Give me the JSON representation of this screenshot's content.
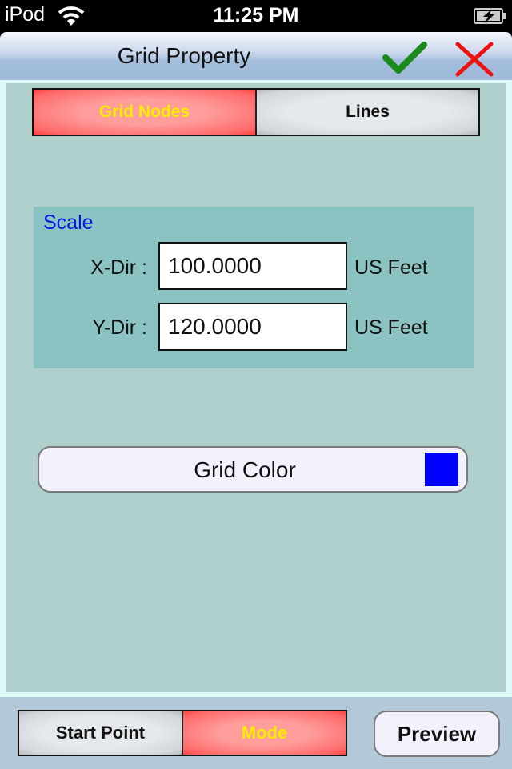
{
  "status_bar": {
    "carrier": "iPod",
    "time": "11:25 PM",
    "wifi_icon": "wifi-icon",
    "battery_icon": "battery-charging-icon"
  },
  "nav": {
    "title": "Grid Property",
    "confirm_icon": "checkmark-icon",
    "cancel_icon": "close-x-icon"
  },
  "top_segment": {
    "items": [
      {
        "label": "Grid Nodes",
        "selected": true
      },
      {
        "label": "Lines",
        "selected": false
      }
    ]
  },
  "scale": {
    "title": "Scale",
    "rows": [
      {
        "label": "X-Dir :",
        "value": "100.0000",
        "unit": "US Feet"
      },
      {
        "label": "Y-Dir :",
        "value": "120.0000",
        "unit": "US Feet"
      }
    ]
  },
  "grid_color": {
    "label": "Grid Color",
    "color": "#0000ff"
  },
  "bottom_segment": {
    "items": [
      {
        "label": "Start Point",
        "selected": false
      },
      {
        "label": "Mode",
        "selected": true
      }
    ]
  },
  "preview_label": "Preview",
  "colors": {
    "selected_text": "#ffee00",
    "confirm": "#1a8a1a",
    "cancel": "#ee1111",
    "scale_title": "#0018e0"
  }
}
